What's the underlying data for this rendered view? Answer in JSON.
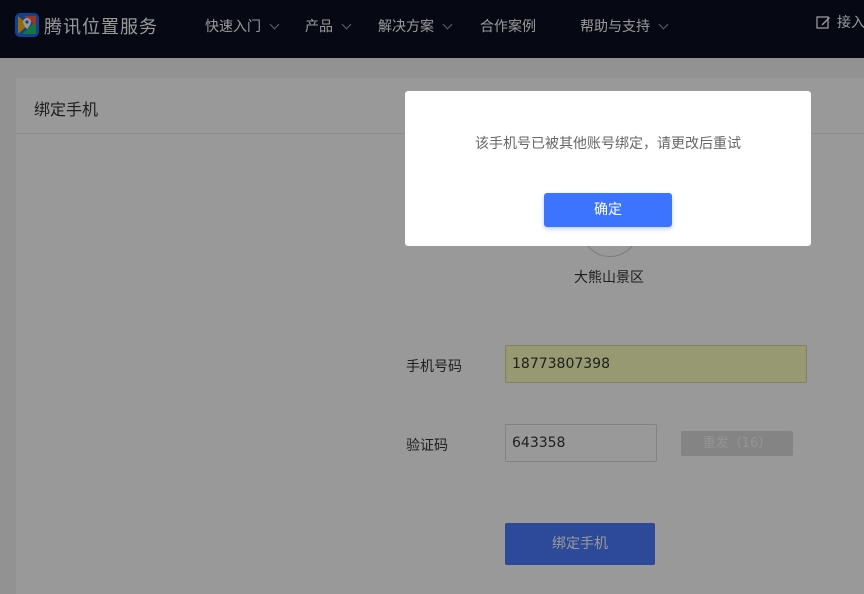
{
  "header": {
    "brand": "腾讯位置服务",
    "nav": [
      {
        "label": "快速入门",
        "has_dropdown": true
      },
      {
        "label": "产品",
        "has_dropdown": true
      },
      {
        "label": "解决方案",
        "has_dropdown": true
      },
      {
        "label": "合作案例",
        "has_dropdown": false
      },
      {
        "label": "帮助与支持",
        "has_dropdown": true
      }
    ],
    "login_label": "接入",
    "login_icon": "edit-icon"
  },
  "page": {
    "title": "绑定手机",
    "avatar_name": "大熊山景区"
  },
  "form": {
    "phone_label": "手机号码",
    "phone_value": "18773807398",
    "code_label": "验证码",
    "code_value": "643358",
    "resend_label": "重发（16）",
    "submit_label": "绑定手机"
  },
  "modal": {
    "message": "该手机号已被其他账号绑定，请更改后重试",
    "confirm_label": "确定"
  },
  "colors": {
    "header_bg": "#0b1021",
    "primary": "#3d74ff",
    "autofill_bg": "#faffbd"
  }
}
